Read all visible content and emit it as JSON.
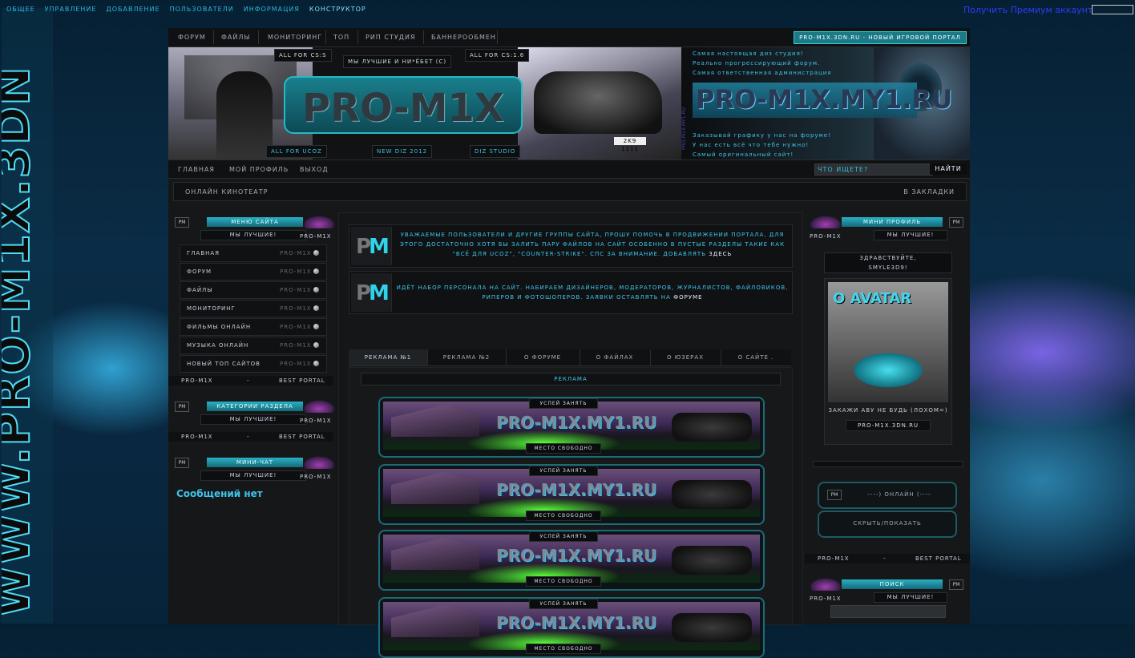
{
  "topbar": {
    "links": [
      "Общее",
      "Управление",
      "Добавление",
      "Пользователи",
      "Информация",
      "Конструктор"
    ],
    "premium": "Получить Премиум аккаунт"
  },
  "nav": {
    "items": [
      "Форум",
      "Файлы",
      "Мониторинг",
      "Топ",
      "РИП Студия",
      "Баннерообмен"
    ],
    "new_portal": "PRO-M1X.3DN.RU - НОВЫЙ ИГРОВОЙ ПОРТАЛ"
  },
  "banner": {
    "logo": "PRO-M1X",
    "tag_cs": "ALL FOR CS:S",
    "tag_best": "МЫ ЛУЧШИЕ И НИ*ЁБЕТ (С)",
    "tag_cs16": "ALL FOR CS:1.6",
    "tag_ucoz": "ALL FOR UCOZ",
    "tag_diz": "NEW DIZ 2012",
    "tag_studio": "DIZ STUDIO",
    "plate": "2K9 1111",
    "right_logo": "PRO-M1X.MY1.RU",
    "vertical": "PRO-M1X.MY1.RU",
    "right_lines_top": [
      "Самая настоящая диз студия!",
      "Реально прогрессирующий форум.",
      "Самая ответственная администрация"
    ],
    "right_lines_bottom": [
      "Заказывай графику у нас на форуме!",
      "У нас есть всё что тебе нужно!",
      "Самый оригинальный сайт!"
    ]
  },
  "bar2": {
    "items": [
      "Главная",
      "Мой профиль",
      "Выход"
    ],
    "search_placeholder": "Что ищете?",
    "find": "Найти"
  },
  "bar3": {
    "left": "Онлайн кинотеатр",
    "right": "В закладки"
  },
  "left": {
    "menu_title": "Меню сайта",
    "sub": "МЫ ЛУЧШИЕ!",
    "brand": "PRO-M1X",
    "pm": "PM",
    "menu": [
      {
        "label": "Главная",
        "tag": "PRO-M1X"
      },
      {
        "label": "Форум",
        "tag": "PRO-M1X"
      },
      {
        "label": "Файлы",
        "tag": "PRO-M1X"
      },
      {
        "label": "Мониторинг",
        "tag": "PRO-M1X"
      },
      {
        "label": "Фильмы онлайн",
        "tag": "PRO-M1X"
      },
      {
        "label": "Музыка онлайн",
        "tag": "PRO-M1X"
      },
      {
        "label": "Новый топ сайтов",
        "tag": "PRO-M1X"
      }
    ],
    "foot_left": "PRO-M1X",
    "foot_mid": "-",
    "foot_right": "BEST PORTAL",
    "cat_title": "Категории раздела",
    "chat_title": "Мини-чат",
    "chat_empty": "Сообщений нет"
  },
  "center": {
    "notice1": "Уважаемые пользователи и другие группы сайта, прошу помочь в продвижении портала, для этого достаточно хотя бы залить пару файлов на сайт особенно в пустые разделы такие как \"Всё для uCoz\", \"Counter-Strike\". Спс за внимание. Добавлять",
    "notice1_link": "здесь",
    "notice2": "Идёт набор персонала на сайт. Набираем дизайнеров, модераторов, журналистов, файловиков, риперов и фотошоперов. Заявки оставлять на",
    "notice2_link": "форуме",
    "tabs": [
      "Реклама №1",
      "Реклама №2",
      "О форуме",
      "О файлах",
      "О юзерах",
      "О сайте ."
    ],
    "ads_title": "Реклама",
    "ad_top": "Успей занять",
    "ad_logo": "PRO-M1X.MY1.RU",
    "ad_bottom": "Место свободно",
    "pm_p": "P",
    "pm_m": "M"
  },
  "right": {
    "profile_title": "Мини профиль",
    "sub": "МЫ ЛУЧШИЕ!",
    "brand": "PRO-M1X",
    "pm": "PM",
    "hello1": "Здравствуйте,",
    "hello2": "Smyle3D9!",
    "avatar_text": "O AVATAR",
    "avatar_cap": "Закажи аву не будь (ЛОХОМ=)",
    "avatar_link": "PRO-M1X.3DN.RU",
    "online": "----) ОнЛАЙН (----",
    "toggle": "Скрыть/Показать",
    "foot_left": "PRO-M1X",
    "foot_mid": "-",
    "foot_right": "BEST PORTAL",
    "search_title": "Поиск"
  }
}
